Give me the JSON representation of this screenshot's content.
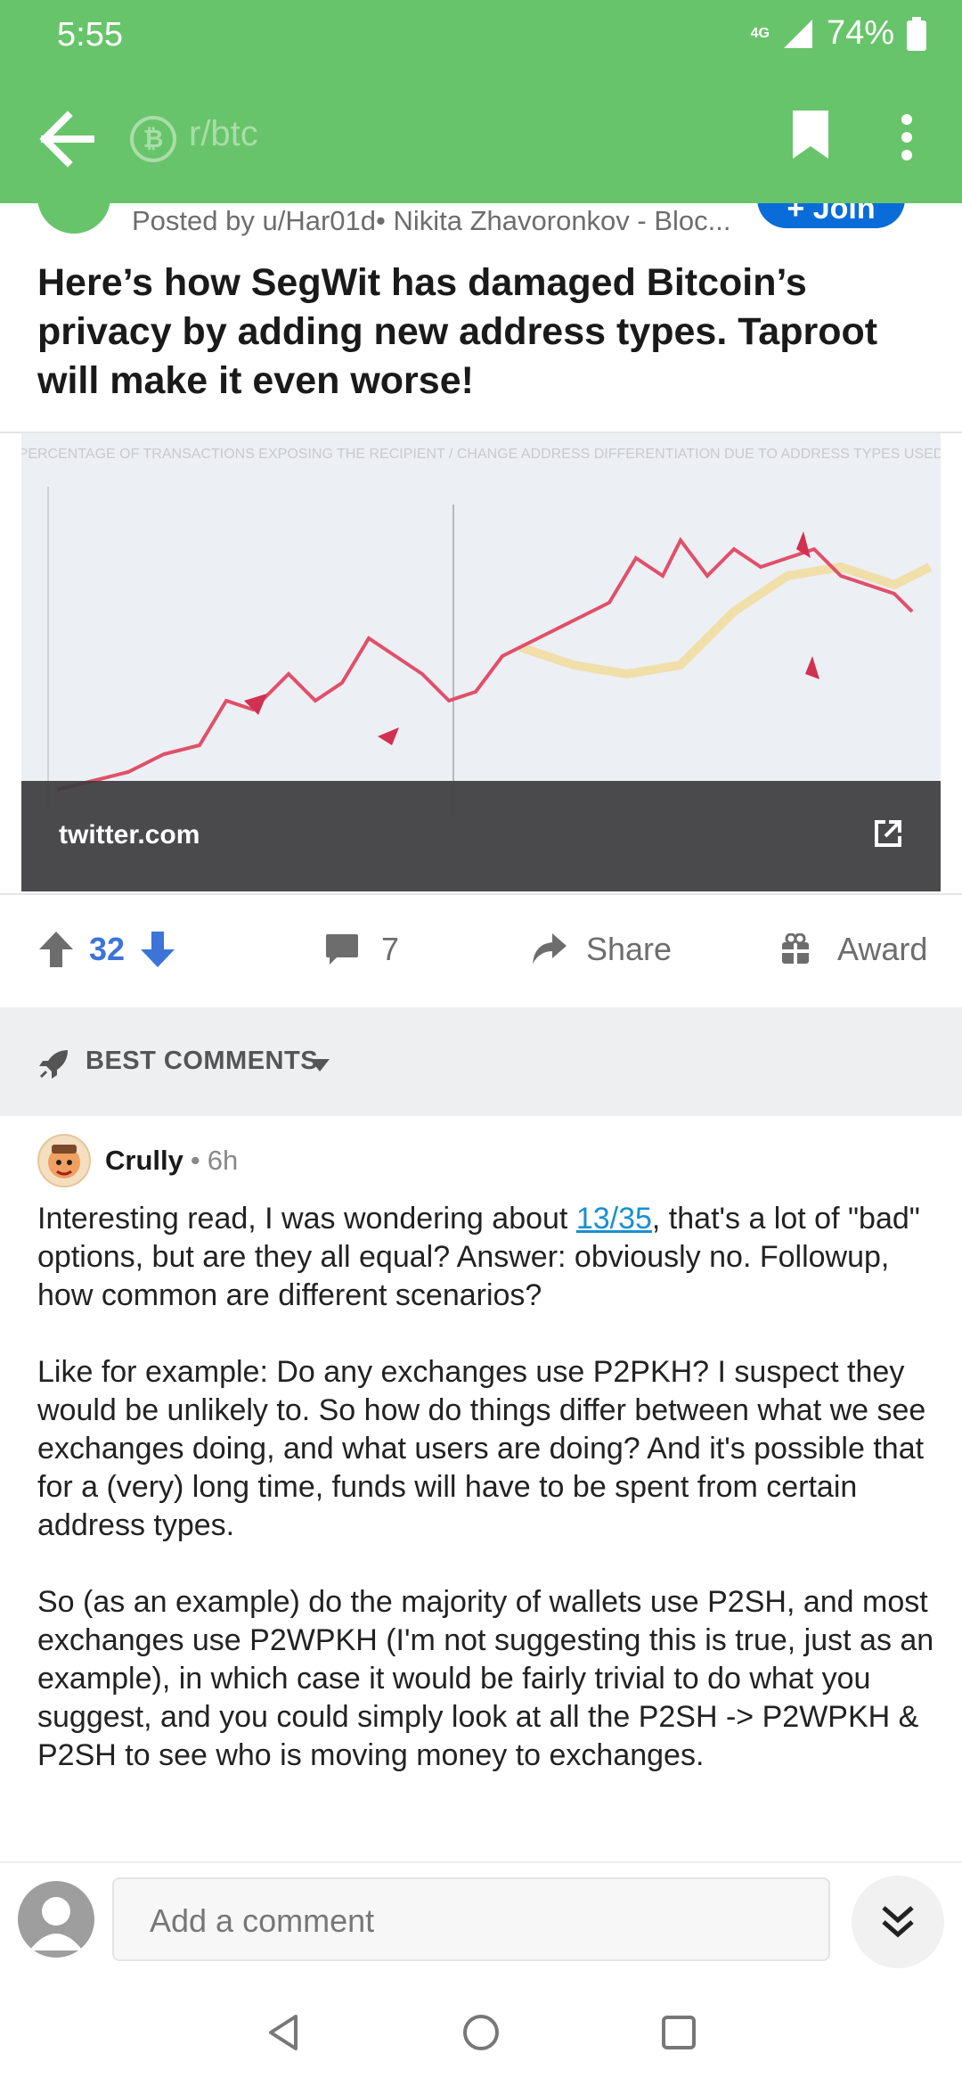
{
  "status_bar": {
    "time": "5:55",
    "network": "4G",
    "battery": "74%"
  },
  "header": {
    "subreddit": "r/btc"
  },
  "post": {
    "meta": "Posted by u/Har01d• Nikita Zhavoronkov - Bloc...",
    "join_label": "+ Join",
    "title": "Here’s how SegWit has damaged Bitcoin’s privacy by adding new address types. Taproot will make it even worse!",
    "link_domain": "twitter.com",
    "preview_chart_title": "PERCENTAGE OF TRANSACTIONS EXPOSING THE RECIPIENT / CHANGE ADDRESS DIFFERENTIATION DUE TO ADDRESS TYPES USED"
  },
  "actions": {
    "upvotes": "32",
    "comments": "7",
    "share": "Share",
    "award": "Award"
  },
  "comments_header": {
    "sort_label": "BEST COMMENTS"
  },
  "comment": {
    "author": "Crully",
    "dot": "•",
    "age": "6h",
    "p1_before": "Interesting read, I was wondering about ",
    "p1_link": "13/35",
    "p1_after": ", that's a lot of \"bad\" options, but are they all equal? Answer: obviously no. Followup, how common are different scenarios?",
    "p2": "Like for example: Do any exchanges use P2PKH? I suspect they would be unlikely to.  So how do things differ between what we see exchanges doing, and what users are doing? And it's possible that for a (very) long time, funds will have to be spent from certain address types.",
    "p3": "So (as an example) do the majority of wallets use P2SH, and most exchanges use P2WPKH (I'm not suggesting this is true, just as an example), in which case it would be fairly trivial to do what you suggest, and you could simply look at all the P2SH -> P2WPKH & P2SH to see who is moving money to exchanges."
  },
  "comment_input": {
    "placeholder": "Add a comment"
  },
  "colors": {
    "header_green": "#68c46a",
    "upvote_blue": "#3c74d8",
    "link_blue": "#1a8fd2",
    "join_blue": "#0a6cd8"
  }
}
